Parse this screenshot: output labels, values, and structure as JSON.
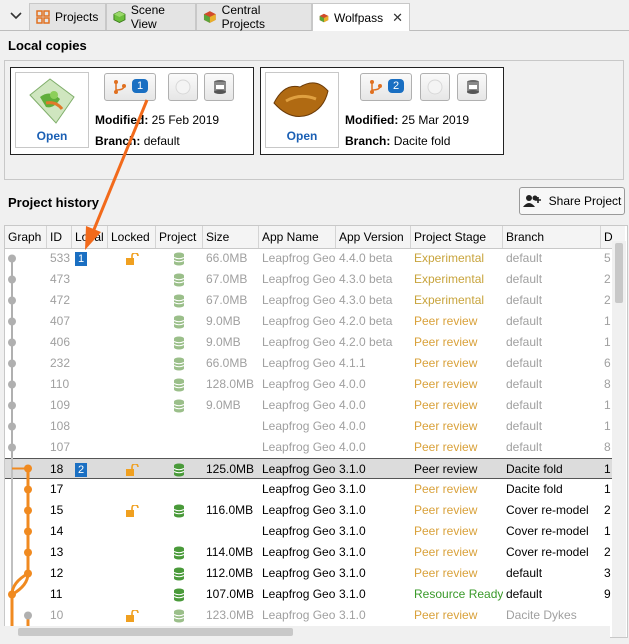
{
  "tabs": [
    {
      "label": "Projects",
      "icon": "projects-icon",
      "active": false
    },
    {
      "label": "Scene View",
      "icon": "cube-icon",
      "active": false
    },
    {
      "label": "Central Projects",
      "icon": "central-icon",
      "active": false
    },
    {
      "label": "Wolfpass",
      "icon": "wolfpass-icon",
      "active": true,
      "close": "✕"
    }
  ],
  "local": {
    "title": "Local copies",
    "cards": [
      {
        "open": "Open",
        "badge": "1",
        "modified_label": "Modified:",
        "modified": "25 Feb 2019",
        "branch_label": "Branch:",
        "branch": "default"
      },
      {
        "open": "Open",
        "badge": "2",
        "modified_label": "Modified:",
        "modified": "25 Mar 2019",
        "branch_label": "Branch:",
        "branch": "Dacite fold"
      }
    ]
  },
  "history": {
    "title": "Project history",
    "share_label": "Share Project",
    "columns": [
      "Graph",
      "ID",
      "Local",
      "Locked",
      "Project",
      "Size",
      "App Name",
      "App Version",
      "Project Stage",
      "Branch",
      "D"
    ],
    "rows": [
      {
        "id": "533",
        "local": "1",
        "locked": true,
        "project": true,
        "size": "66.0MB",
        "app": "Leapfrog Geo",
        "ver": "4.4.0 beta",
        "stage": "Experimental",
        "branch": "default",
        "d": "5",
        "style": "grey",
        "stage_color": "olive"
      },
      {
        "id": "473",
        "local": "",
        "locked": false,
        "project": true,
        "size": "67.0MB",
        "app": "Leapfrog Geo",
        "ver": "4.3.0 beta",
        "stage": "Experimental",
        "branch": "default",
        "d": "2",
        "style": "grey",
        "stage_color": "olive"
      },
      {
        "id": "472",
        "local": "",
        "locked": false,
        "project": true,
        "size": "67.0MB",
        "app": "Leapfrog Geo",
        "ver": "4.3.0 beta",
        "stage": "Experimental",
        "branch": "default",
        "d": "2",
        "style": "grey",
        "stage_color": "olive"
      },
      {
        "id": "407",
        "local": "",
        "locked": false,
        "project": true,
        "size": "9.0MB",
        "app": "Leapfrog Geo",
        "ver": "4.2.0 beta",
        "stage": "Peer review",
        "branch": "default",
        "d": "1",
        "style": "grey",
        "stage_color": "orange"
      },
      {
        "id": "406",
        "local": "",
        "locked": false,
        "project": true,
        "size": "9.0MB",
        "app": "Leapfrog Geo",
        "ver": "4.2.0 beta",
        "stage": "Peer review",
        "branch": "default",
        "d": "1",
        "style": "grey",
        "stage_color": "orange"
      },
      {
        "id": "232",
        "local": "",
        "locked": false,
        "project": true,
        "size": "66.0MB",
        "app": "Leapfrog Geo",
        "ver": "4.1.1",
        "stage": "Peer review",
        "branch": "default",
        "d": "6",
        "style": "grey",
        "stage_color": "orange"
      },
      {
        "id": "110",
        "local": "",
        "locked": false,
        "project": true,
        "size": "128.0MB",
        "app": "Leapfrog Geo",
        "ver": "4.0.0",
        "stage": "Peer review",
        "branch": "default",
        "d": "8",
        "style": "grey",
        "stage_color": "orange"
      },
      {
        "id": "109",
        "local": "",
        "locked": false,
        "project": true,
        "size": "9.0MB",
        "app": "Leapfrog Geo",
        "ver": "4.0.0",
        "stage": "Peer review",
        "branch": "default",
        "d": "1",
        "style": "grey",
        "stage_color": "orange"
      },
      {
        "id": "108",
        "local": "",
        "locked": false,
        "project": false,
        "size": "",
        "app": "Leapfrog Geo",
        "ver": "4.0.0",
        "stage": "Peer review",
        "branch": "default",
        "d": "1",
        "style": "grey",
        "stage_color": "orange"
      },
      {
        "id": "107",
        "local": "",
        "locked": false,
        "project": false,
        "size": "",
        "app": "Leapfrog Geo",
        "ver": "4.0.0",
        "stage": "Peer review",
        "branch": "default",
        "d": "8",
        "style": "grey",
        "stage_color": "orange"
      },
      {
        "id": "18",
        "local": "2",
        "locked": true,
        "project": true,
        "size": "125.0MB",
        "app": "Leapfrog Geo",
        "ver": "3.1.0",
        "stage": "Peer review",
        "branch": "Dacite fold",
        "d": "1",
        "style": "sel",
        "stage_color": "dark"
      },
      {
        "id": "17",
        "local": "",
        "locked": false,
        "project": false,
        "size": "",
        "app": "Leapfrog Geo",
        "ver": "3.1.0",
        "stage": "Peer review",
        "branch": "Dacite fold",
        "d": "1",
        "style": "normal",
        "stage_color": "orange"
      },
      {
        "id": "15",
        "local": "",
        "locked": true,
        "project": true,
        "size": "116.0MB",
        "app": "Leapfrog Geo",
        "ver": "3.1.0",
        "stage": "Peer review",
        "branch": "Cover re-model",
        "d": "2",
        "style": "normal",
        "stage_color": "orange"
      },
      {
        "id": "14",
        "local": "",
        "locked": false,
        "project": false,
        "size": "",
        "app": "Leapfrog Geo",
        "ver": "3.1.0",
        "stage": "Peer review",
        "branch": "Cover re-model",
        "d": "1",
        "style": "normal",
        "stage_color": "orange"
      },
      {
        "id": "13",
        "local": "",
        "locked": false,
        "project": true,
        "size": "114.0MB",
        "app": "Leapfrog Geo",
        "ver": "3.1.0",
        "stage": "Peer review",
        "branch": "Cover re-model",
        "d": "2",
        "style": "normal",
        "stage_color": "orange"
      },
      {
        "id": "12",
        "local": "",
        "locked": false,
        "project": true,
        "size": "112.0MB",
        "app": "Leapfrog Geo",
        "ver": "3.1.0",
        "stage": "Peer review",
        "branch": "default",
        "d": "3",
        "style": "normal",
        "stage_color": "orange"
      },
      {
        "id": "11",
        "local": "",
        "locked": false,
        "project": true,
        "size": "107.0MB",
        "app": "Leapfrog Geo",
        "ver": "3.1.0",
        "stage": "Resource Ready",
        "branch": "default",
        "d": "9",
        "style": "normal",
        "stage_color": "green"
      },
      {
        "id": "10",
        "local": "",
        "locked": true,
        "project": true,
        "size": "123.0MB",
        "app": "Leapfrog Geo",
        "ver": "3.1.0",
        "stage": "Peer review",
        "branch": "Dacite Dykes",
        "d": "",
        "style": "grey",
        "stage_color": "orange"
      }
    ]
  }
}
